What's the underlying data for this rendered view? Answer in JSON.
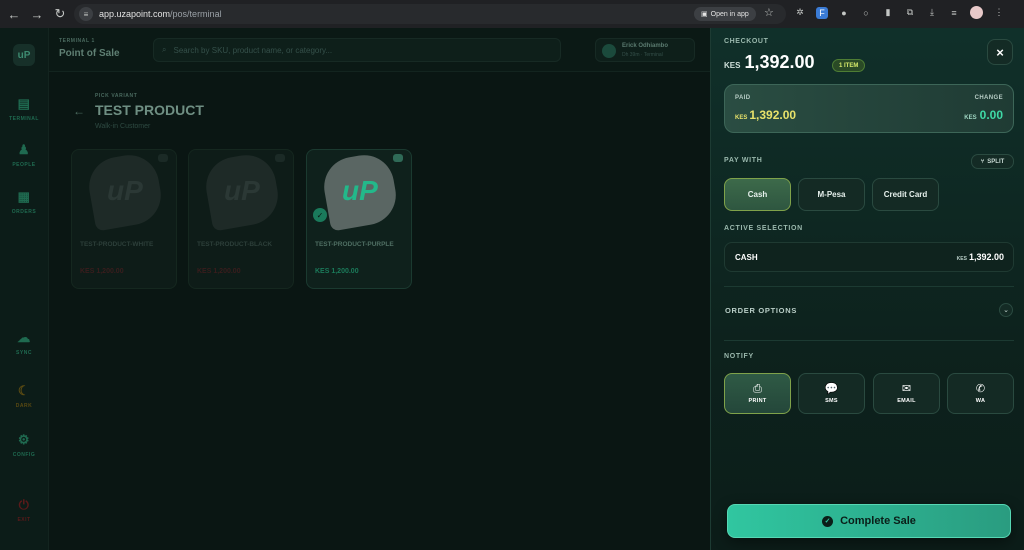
{
  "browser": {
    "url_host": "app.uzapoint.com",
    "url_path": "/pos/terminal",
    "open_in_app": "Open in app"
  },
  "topbar": {
    "terminal_label": "TERMINAL 1",
    "title": "Point of Sale",
    "search_placeholder": "Search by SKU, product name, or category...",
    "user_name": "Erick Odhiambo",
    "user_sub": "Dh 39m · Terminal"
  },
  "sidebar": {
    "items": [
      {
        "label": "TERMINAL",
        "icon": "terminal-icon"
      },
      {
        "label": "PEOPLE",
        "icon": "people-icon"
      },
      {
        "label": "ORDERS",
        "icon": "orders-icon"
      },
      {
        "label": "SYNC",
        "icon": "cloud-icon"
      },
      {
        "label": "DARK",
        "icon": "moon-icon"
      },
      {
        "label": "CONFIG",
        "icon": "gear-icon"
      },
      {
        "label": "EXIT",
        "icon": "power-icon"
      }
    ]
  },
  "product": {
    "label": "PICK VARIANT",
    "title": "TEST PRODUCT",
    "customer": "Walk-in Customer",
    "variants": [
      {
        "name": "TEST-PRODUCT-WHITE",
        "price": "KES 1,200.00",
        "selected": false
      },
      {
        "name": "TEST-PRODUCT-BLACK",
        "price": "KES 1,200.00",
        "selected": false
      },
      {
        "name": "TEST-PRODUCT-PURPLE",
        "price": "KES 1,200.00",
        "selected": true
      }
    ],
    "logo_text": "uP"
  },
  "checkout": {
    "label": "CHECKOUT",
    "currency": "KES",
    "total": "1,392.00",
    "items_badge": "1 ITEM",
    "close": "×",
    "paid_label": "PAID",
    "paid_currency": "KES",
    "paid_value": "1,392.00",
    "change_label": "CHANGE",
    "change_currency": "KES",
    "change_value": "0.00",
    "pay_with_label": "PAY WITH",
    "split_label": "SPLIT",
    "pay_methods": [
      "Cash",
      "M-Pesa",
      "Credit Card"
    ],
    "active_method": "Cash",
    "active_selection_label": "ACTIVE SELECTION",
    "active_selection_name": "CASH",
    "active_selection_currency": "KES",
    "active_selection_value": "1,392.00",
    "order_options_label": "ORDER OPTIONS",
    "notify_label": "NOTIFY",
    "notify": [
      {
        "label": "PRINT",
        "icon": "printer-icon"
      },
      {
        "label": "SMS",
        "icon": "sms-icon"
      },
      {
        "label": "EMAIL",
        "icon": "email-icon"
      },
      {
        "label": "WA",
        "icon": "whatsapp-icon"
      }
    ],
    "complete_label": "Complete Sale"
  },
  "colors": {
    "accent": "#30c6a0",
    "paid_value": "#e8e26a",
    "change_value": "#3fd9a6",
    "badge": "#d6e96a"
  }
}
